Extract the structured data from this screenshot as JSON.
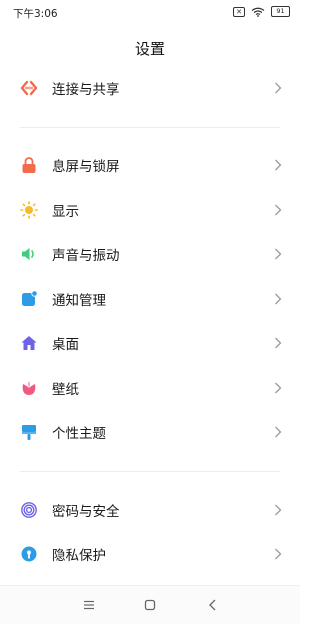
{
  "status_bar": {
    "time": "下午3:06",
    "battery": "91"
  },
  "page": {
    "title": "设置"
  },
  "sections": [
    {
      "items": [
        {
          "label": "连接与共享",
          "icon": "connection-share-icon",
          "color": "#f26b4a"
        }
      ]
    },
    {
      "items": [
        {
          "label": "息屏与锁屏",
          "icon": "lock-icon",
          "color": "#f26b4a"
        },
        {
          "label": "显示",
          "icon": "sun-icon",
          "color": "#f7bb2a"
        },
        {
          "label": "声音与振动",
          "icon": "speaker-icon",
          "color": "#3fcf7a"
        },
        {
          "label": "通知管理",
          "icon": "notification-icon",
          "color": "#2e9be6"
        },
        {
          "label": "桌面",
          "icon": "home-icon",
          "color": "#6e63e8"
        },
        {
          "label": "壁纸",
          "icon": "flower-icon",
          "color": "#ef5a83"
        },
        {
          "label": "个性主题",
          "icon": "brush-icon",
          "color": "#2e9be6"
        }
      ]
    },
    {
      "items": [
        {
          "label": "密码与安全",
          "icon": "fingerprint-icon",
          "color": "#6e63e8"
        },
        {
          "label": "隐私保护",
          "icon": "privacy-icon",
          "color": "#2e9be6"
        }
      ]
    }
  ],
  "nav_bar": {
    "buttons": [
      "menu-icon",
      "home-square-icon",
      "back-icon"
    ]
  }
}
